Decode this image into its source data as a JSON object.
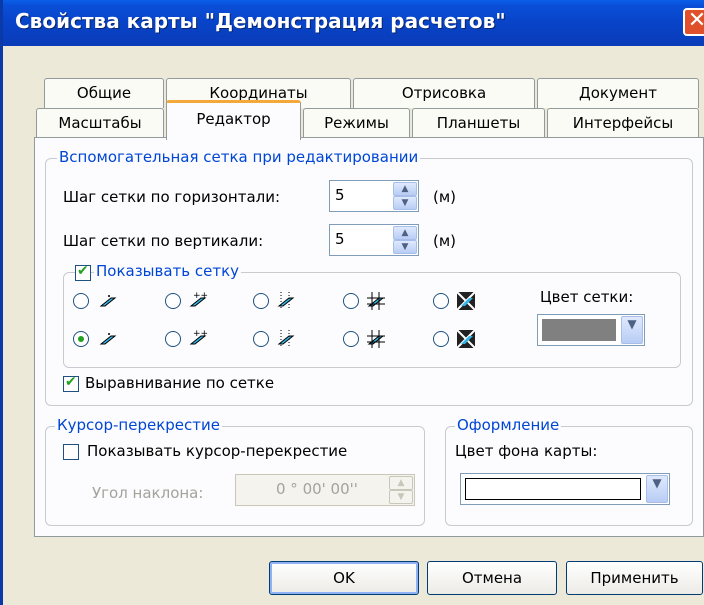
{
  "window": {
    "title": "Свойства карты \"Демонстрация расчетов\"",
    "close_label": "✕"
  },
  "tabs_back": [
    "Общие",
    "Координаты",
    "Отрисовка",
    "Документ"
  ],
  "tabs_front": [
    "Масштабы",
    "Редактор",
    "Режимы",
    "Планшеты",
    "Интерфейсы"
  ],
  "active_tab": "Редактор",
  "grid_group": {
    "legend": "Вспомогательная сетка при редактировании",
    "h_step_label": "Шаг сетки по горизонтали:",
    "h_step_value": "5",
    "v_step_label": "Шаг сетки по вертикали:",
    "v_step_value": "5",
    "unit": "(м)",
    "show_grid_label": "Показывать сетку",
    "show_grid_checked": true,
    "grid_color_label": "Цвет сетки:",
    "grid_color": "#808080",
    "snap_label": "Выравнивание по сетке",
    "snap_checked": true,
    "selected_style_index": 5
  },
  "cursor_group": {
    "legend": "Курсор-перекрестие",
    "show_cursor_label": "Показывать курсор-перекрестие",
    "show_cursor_checked": false,
    "angle_label": "Угол наклона:",
    "angle_value": "0 ° 00' 00''"
  },
  "design_group": {
    "legend": "Оформление",
    "bg_color_label": "Цвет фона карты:",
    "bg_color": "#ffffff"
  },
  "buttons": {
    "ok": "OK",
    "cancel": "Отмена",
    "apply": "Применить"
  },
  "colors": {
    "accent": "#0046d5",
    "title_bar": "#0843c8",
    "check": "#21a121"
  }
}
